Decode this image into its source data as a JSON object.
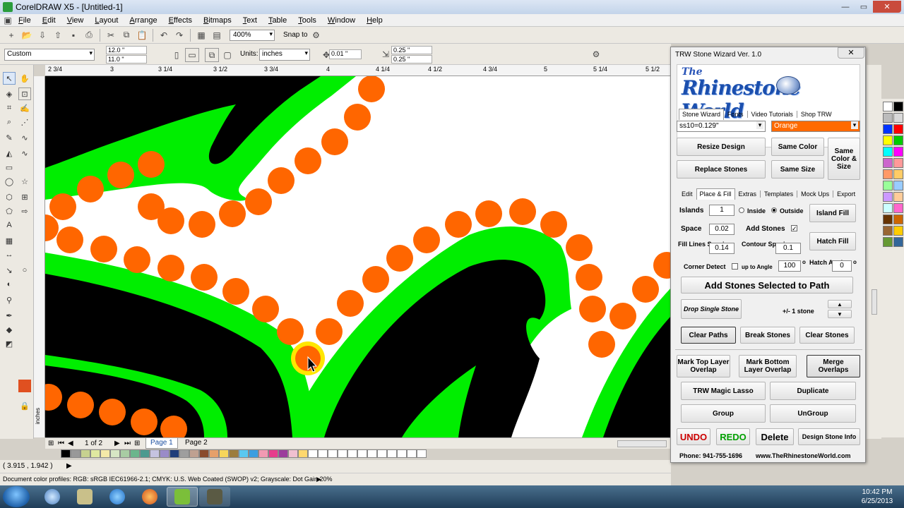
{
  "window": {
    "title": "CorelDRAW X5 - [Untitled-1]"
  },
  "menu": [
    "File",
    "Edit",
    "View",
    "Layout",
    "Arrange",
    "Effects",
    "Bitmaps",
    "Text",
    "Table",
    "Tools",
    "Window",
    "Help"
  ],
  "toolbar": {
    "zoom": "400%",
    "snap_to": "Snap to"
  },
  "propbar": {
    "preset": "Custom",
    "width": "12.0 \"",
    "height": "11.0 \"",
    "units_label": "Units:",
    "units": "inches",
    "nudge": "0.01 \"",
    "dup_x": "0.25 \"",
    "dup_y": "0.25 \""
  },
  "ruler": {
    "h_labels": [
      "2 3/4",
      "3",
      "3 1/4",
      "3 1/2",
      "3 3/4",
      "4",
      "4 1/4",
      "4 1/2",
      "4 3/4",
      "5",
      "5 1/4",
      "5 1/2"
    ],
    "h_partial": "inches",
    "v_label": "inches"
  },
  "pagenav": {
    "count": "1 of 2",
    "pages": [
      "Page 1",
      "Page 2"
    ]
  },
  "status": {
    "coords": "( 3.915 , 1.942 )",
    "color_profiles": "Document color profiles: RGB: sRGB IEC61966-2.1; CMYK: U.S. Web Coated (SWOP) v2; Grayscale: Dot Gain 20%"
  },
  "colors": {
    "stone": "#ff6600",
    "outline": "#00ee00",
    "fill": "#000000",
    "highlight": "#ffe600",
    "orange_select": "#ff6a00"
  },
  "palette_bottom": [
    "#000000",
    "#999999",
    "#c7d18f",
    "#dfe8a0",
    "#f4e9a8",
    "#d7e6c4",
    "#a8cca3",
    "#6bb68c",
    "#4b9a8f",
    "#c5c3e0",
    "#9a8bc8",
    "#1f3d7a",
    "#9e9e9e",
    "#bfa090",
    "#8a4b2d",
    "#e6a06a",
    "#f6d55a",
    "#9c7c3c",
    "#5ac8f0",
    "#3b9ee0",
    "#f29ab2",
    "#e63c8c",
    "#9c3c9c",
    "#f0c0d0",
    "#ffd86e",
    "#ffffff",
    "#ffffff",
    "#ffffff",
    "#ffffff",
    "#ffffff",
    "#ffffff",
    "#ffffff",
    "#ffffff",
    "#ffffff",
    "#ffffff",
    "#ffffff",
    "#ffffff"
  ],
  "palette_right": [
    "#ffffff",
    "#000000",
    "#bcbcbc",
    "#d9d9d9",
    "#0033ff",
    "#ff0000",
    "#ffff00",
    "#00cc00",
    "#00ffff",
    "#ff00ff",
    "#cc66cc",
    "#ff9999",
    "#ff9966",
    "#ffcc66",
    "#99ff99",
    "#99ccff",
    "#cc99ff",
    "#ffcc99",
    "#ccffff",
    "#ff66cc",
    "#663300",
    "#cc6600",
    "#996633",
    "#ffcc00",
    "#669933",
    "#336699"
  ],
  "trw": {
    "title": "TRW Stone Wizard Ver. 1.0",
    "logo": {
      "the": "The",
      "name": "Rhinestone World"
    },
    "tabs_top": [
      "Stone Wizard",
      "Fonts",
      "Video Tutorials",
      "Shop TRW"
    ],
    "stone_size": "ss10=0.129\"",
    "stone_color": "Orange",
    "btn_resize": "Resize Design",
    "btn_same_color": "Same Color",
    "btn_same_color_size": "Same Color & Size",
    "btn_replace": "Replace Stones",
    "btn_same_size": "Same Size",
    "tabs_mid": [
      "Edit",
      "Place & Fill",
      "Extras",
      "Templates",
      "Mock Ups",
      "Export"
    ],
    "islands_label": "Islands",
    "islands_value": "1",
    "inside_label": "Inside",
    "outside_label": "Outside",
    "btn_island_fill": "Island Fill",
    "space_label": "Space",
    "space_value": "0.02",
    "add_stones_label": "Add Stones",
    "check_mark": "✓",
    "fill_lines_label": "Fill Lines Spacing",
    "fill_lines_value": "0.14",
    "contour_label": "Contour Spacing",
    "contour_value": "0.1",
    "btn_hatch_fill": "Hatch Fill",
    "corner_label": "Corner Detect",
    "up_to_angle_label": "up to Angle",
    "angle_value": "100",
    "degree": "o",
    "hatch_angle_label": "Hatch Angle",
    "hatch_angle_value": "0",
    "btn_add_path": "Add Stones Selected to Path",
    "btn_drop_single": "Drop Single Stone",
    "pm_label": "+/- 1 stone",
    "btn_clear_paths": "Clear Paths",
    "btn_break_stones": "Break Stones",
    "btn_clear_stones": "Clear Stones",
    "btn_mark_top": "Mark Top Layer Overlap",
    "btn_mark_bottom": "Mark Bottom Layer Overlap",
    "btn_merge": "Merge Overlaps",
    "btn_magic_lasso": "TRW Magic Lasso",
    "btn_duplicate": "Duplicate",
    "btn_group": "Group",
    "btn_ungroup": "UnGroup",
    "btn_undo": "UNDO",
    "btn_redo": "REDO",
    "btn_delete": "Delete",
    "btn_design_info": "Design Stone Info",
    "phone": "Phone: 941-755-1696",
    "website": "www.TheRhinestoneWorld.com"
  },
  "clock": {
    "time": "10:42 PM",
    "date": "6/25/2013"
  }
}
